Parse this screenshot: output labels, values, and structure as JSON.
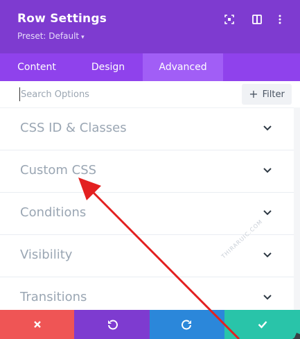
{
  "header": {
    "title": "Row Settings",
    "preset": "Preset: Default",
    "icons": [
      "focus-icon",
      "split-view-icon",
      "more-options-icon"
    ]
  },
  "tabs": [
    {
      "label": "Content",
      "active": false
    },
    {
      "label": "Design",
      "active": false
    },
    {
      "label": "Advanced",
      "active": true
    }
  ],
  "search": {
    "placeholder": "Search Options",
    "filter_label": "Filter"
  },
  "panels": [
    {
      "label": "CSS ID & Classes"
    },
    {
      "label": "Custom CSS"
    },
    {
      "label": "Conditions"
    },
    {
      "label": "Visibility"
    },
    {
      "label": "Transitions"
    }
  ],
  "footer": {
    "buttons": [
      {
        "action": "discard",
        "icon": "x-icon",
        "color": "#ef5555"
      },
      {
        "action": "undo",
        "icon": "undo-icon",
        "color": "#7e3bd0"
      },
      {
        "action": "redo",
        "icon": "redo-icon",
        "color": "#2b87da"
      },
      {
        "action": "save",
        "icon": "check-icon",
        "color": "#29c4a9"
      }
    ]
  },
  "annotation": {
    "type": "arrow",
    "color": "#e32020",
    "points_to": "Custom CSS"
  },
  "colors": {
    "header": "#7e3bd0",
    "tabs": "#8f42ec",
    "active_tab": "#a15ef6"
  }
}
